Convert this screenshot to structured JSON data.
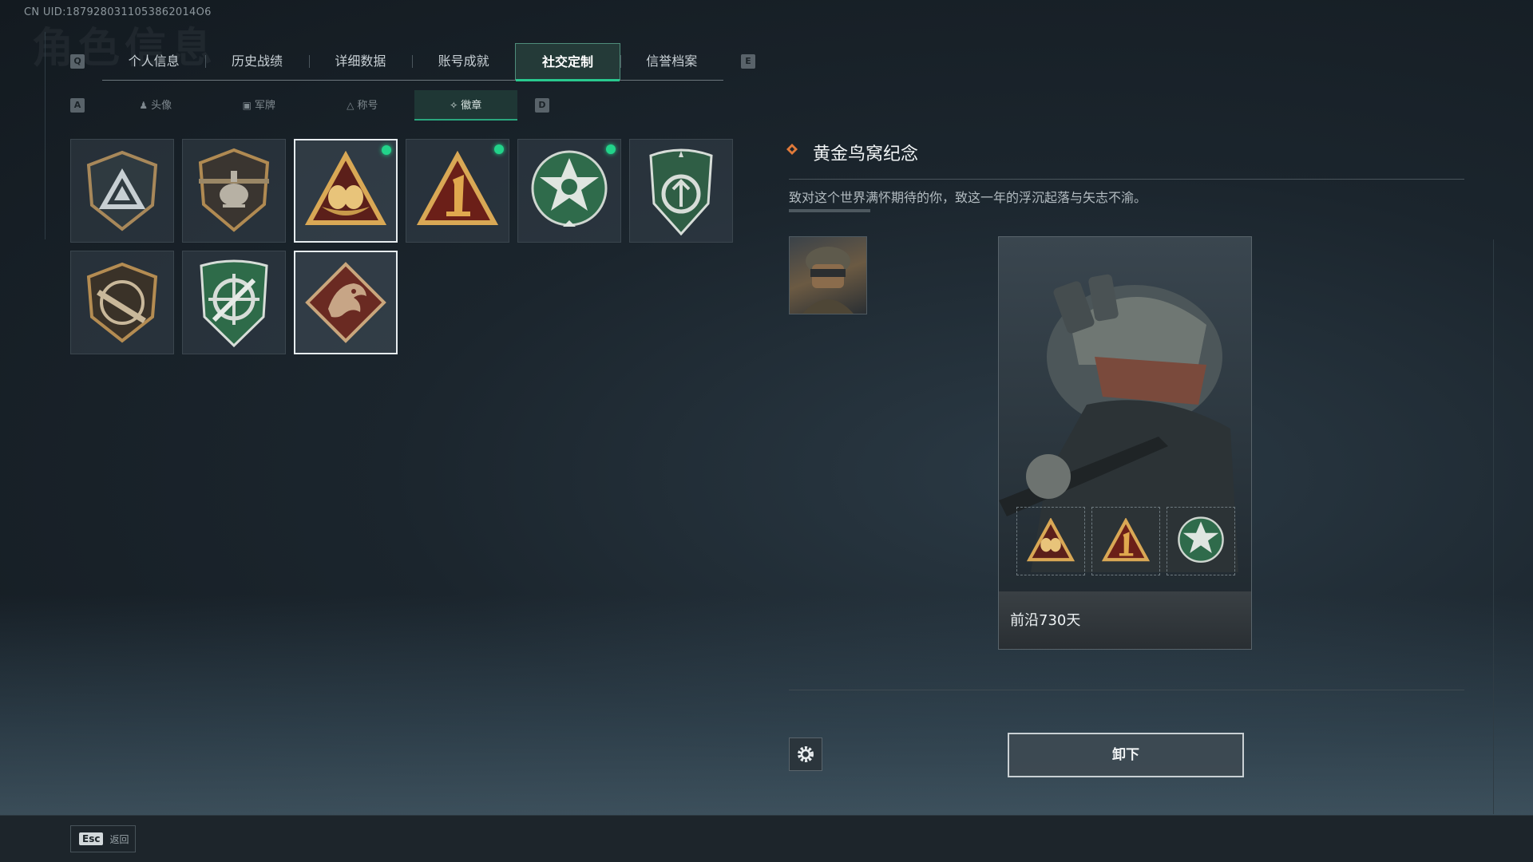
{
  "header": {
    "uid": "CN UID:1879280311053862014O6",
    "bg_title": "角色信息"
  },
  "tabs": {
    "prev_key": "Q",
    "next_key": "E",
    "items": [
      {
        "label": "个人信息"
      },
      {
        "label": "历史战绩"
      },
      {
        "label": "详细数据"
      },
      {
        "label": "账号成就"
      },
      {
        "label": "社交定制"
      },
      {
        "label": "信誉档案"
      }
    ]
  },
  "subtabs": {
    "prev_key": "A",
    "next_key": "D",
    "items": [
      {
        "label": "头像",
        "icon": "person-icon"
      },
      {
        "label": "军牌",
        "icon": "dogtag-icon"
      },
      {
        "label": "称号",
        "icon": "title-icon"
      },
      {
        "label": "徽章",
        "icon": "badge-icon"
      }
    ]
  },
  "badges": [
    {
      "name": "triangle-emblem",
      "equipped": false,
      "selected": false
    },
    {
      "name": "helicopter-emblem",
      "equipped": false,
      "selected": false
    },
    {
      "name": "golden-nest-emblem",
      "equipped": true,
      "selected": true
    },
    {
      "name": "number-one-emblem",
      "equipped": true,
      "selected": false
    },
    {
      "name": "green-star-emblem",
      "equipped": true,
      "selected": false
    },
    {
      "name": "green-shield-emblem",
      "equipped": false,
      "selected": false
    },
    {
      "name": "rifle-emblem",
      "equipped": false,
      "selected": false
    },
    {
      "name": "crosshair-emblem",
      "equipped": false,
      "selected": false
    },
    {
      "name": "dragon-emblem",
      "equipped": false,
      "selected": true
    }
  ],
  "detail": {
    "title": "黄金鸟窝纪念",
    "description": "致对这个世界满怀期待的你，致这一年的浮沉起落与矢志不渝。",
    "card_caption": "前沿730天"
  },
  "actions": {
    "unequip_label": "卸下",
    "esc_key": "Esc",
    "esc_label": "返回"
  },
  "colors": {
    "accent_green": "#22d38a",
    "selected_border": "#e6ecef",
    "title_icon": "#e07a3a"
  }
}
